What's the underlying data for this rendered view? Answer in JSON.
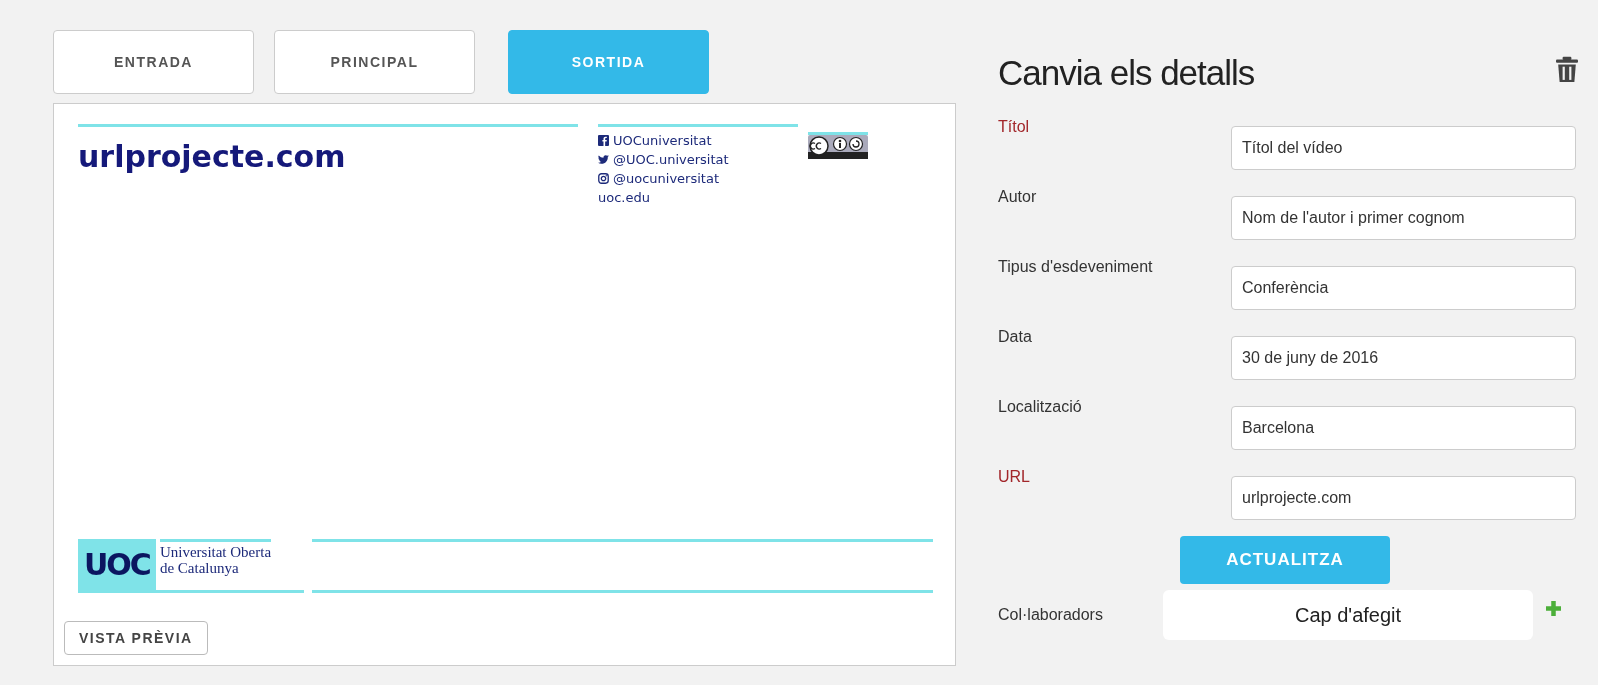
{
  "tabs": [
    {
      "label": "ENTRADA",
      "selected": false
    },
    {
      "label": "PRINCIPAL",
      "selected": false
    },
    {
      "label": "SORTIDA",
      "selected": true
    }
  ],
  "preview": {
    "url": "urlprojecte.com",
    "social": [
      {
        "kind": "facebook",
        "text": "UOCuniversitat"
      },
      {
        "kind": "twitter",
        "text": "@UOC.universitat"
      },
      {
        "kind": "instagram",
        "text": "@uocuniversitat"
      },
      {
        "kind": "web",
        "text": "uoc.edu"
      }
    ],
    "logo_mark": "UOC",
    "logo_lines": [
      "Universitat Oberta",
      "de Catalunya"
    ],
    "preview_button": "VISTA PRÈVIA"
  },
  "details": {
    "title": "Canvia els detalls",
    "fields": [
      {
        "label": "Títol",
        "value": "Títol del vídeo",
        "required": true
      },
      {
        "label": "Autor",
        "value": "Nom de l'autor i primer cognom",
        "required": false
      },
      {
        "label": "Tipus d'esdeveniment",
        "value": "Conferència",
        "required": false
      },
      {
        "label": "Data",
        "value": "30 de juny de 2016",
        "required": false
      },
      {
        "label": "Localització",
        "value": "Barcelona",
        "required": false
      },
      {
        "label": "URL",
        "value": "urlprojecte.com",
        "required": true
      }
    ],
    "update_button": "ACTUALITZA",
    "collaborators": {
      "label": "Col·laboradors",
      "value": "Cap d'afegit"
    }
  }
}
